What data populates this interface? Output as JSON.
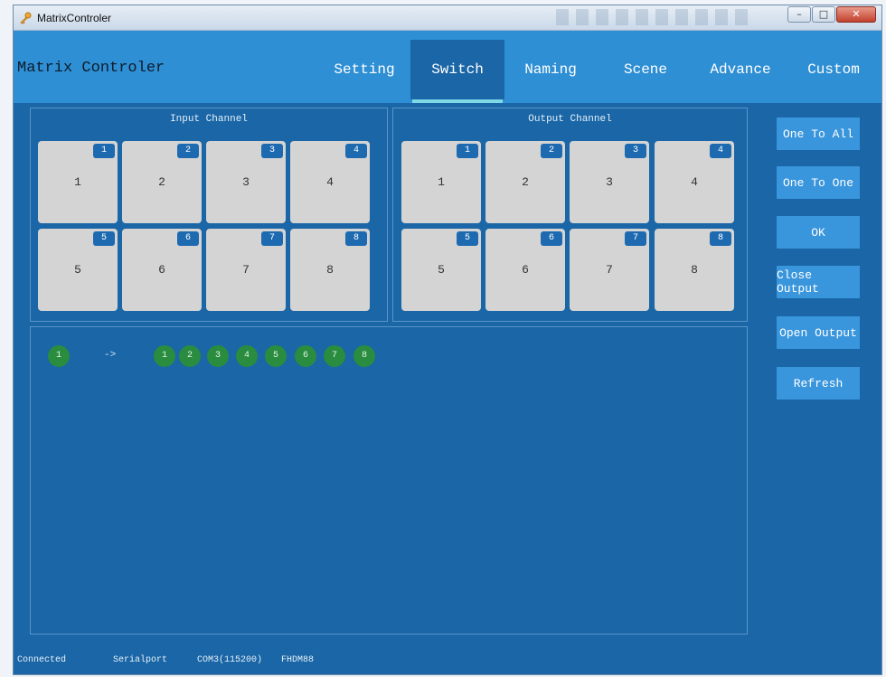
{
  "window": {
    "title": "MatrixControler"
  },
  "header": {
    "app_title": "Matrix Controler"
  },
  "tabs": [
    {
      "label": "Setting",
      "active": false
    },
    {
      "label": "Switch",
      "active": true
    },
    {
      "label": "Naming",
      "active": false
    },
    {
      "label": "Scene",
      "active": false
    },
    {
      "label": "Advance",
      "active": false
    },
    {
      "label": "Custom",
      "active": false
    }
  ],
  "input_panel": {
    "title": "Input Channel",
    "channels": [
      {
        "badge": "1",
        "label": "1"
      },
      {
        "badge": "2",
        "label": "2"
      },
      {
        "badge": "3",
        "label": "3"
      },
      {
        "badge": "4",
        "label": "4"
      },
      {
        "badge": "5",
        "label": "5"
      },
      {
        "badge": "6",
        "label": "6"
      },
      {
        "badge": "7",
        "label": "7"
      },
      {
        "badge": "8",
        "label": "8"
      }
    ]
  },
  "output_panel": {
    "title": "Output Channel",
    "channels": [
      {
        "badge": "1",
        "label": "1"
      },
      {
        "badge": "2",
        "label": "2"
      },
      {
        "badge": "3",
        "label": "3"
      },
      {
        "badge": "4",
        "label": "4"
      },
      {
        "badge": "5",
        "label": "5"
      },
      {
        "badge": "6",
        "label": "6"
      },
      {
        "badge": "7",
        "label": "7"
      },
      {
        "badge": "8",
        "label": "8"
      }
    ]
  },
  "mapping": {
    "source": "1",
    "arrow": "->",
    "targets": [
      "1",
      "2",
      "3",
      "4",
      "5",
      "6",
      "7",
      "8"
    ]
  },
  "actions": [
    {
      "label": "One To All"
    },
    {
      "label": "One To One"
    },
    {
      "label": "OK"
    },
    {
      "label": "Close Output"
    },
    {
      "label": "Open Output"
    },
    {
      "label": "Refresh"
    }
  ],
  "status": {
    "connection": "Connected",
    "port_type": "Serialport",
    "port": "COM3(115200)",
    "device": "FHDM88"
  },
  "colors": {
    "background": "#1a66a6",
    "header": "#2f8fd4",
    "active_tab": "#1a66a6",
    "tab_underline": "#7ed8e6",
    "channel_tile": "#d4d4d4",
    "badge": "#1d6ab0",
    "node": "#2a8c3f",
    "action_button": "#3a96dc"
  },
  "icons": {
    "app": "key-icon",
    "minimize": "minimize-icon",
    "maximize": "maximize-icon",
    "close": "close-icon"
  }
}
